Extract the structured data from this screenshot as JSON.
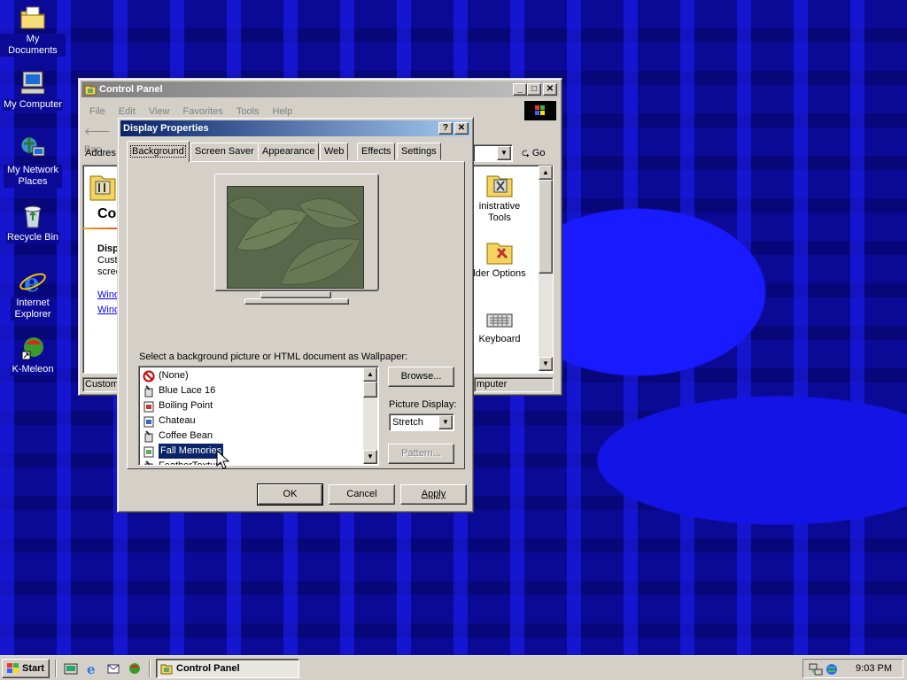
{
  "desktop": {
    "icons": [
      {
        "label": "My Documents",
        "icon": "folder-documents-icon"
      },
      {
        "label": "My Computer",
        "icon": "computer-icon"
      },
      {
        "label": "My Network Places",
        "icon": "network-icon"
      },
      {
        "label": "Recycle Bin",
        "icon": "recycle-bin-icon"
      },
      {
        "label": "Internet Explorer",
        "icon": "internet-explorer-icon"
      },
      {
        "label": "K-Meleon",
        "icon": "k-meleon-icon"
      }
    ]
  },
  "control_panel": {
    "title": "Control Panel",
    "menu": [
      "File",
      "Edit",
      "View",
      "Favorites",
      "Tools",
      "Help"
    ],
    "back_label": "Bac",
    "address_label": "Addres",
    "go_label": "Go",
    "heading": "Cor",
    "info_title": "Displ",
    "info_lines": [
      "Custo",
      "scree"
    ],
    "links": [
      "Windo",
      "Windo"
    ],
    "items": [
      {
        "label": "inistrative Tools",
        "icon": "administrative-tools-icon"
      },
      {
        "label": "lder Options",
        "icon": "folder-options-icon"
      },
      {
        "label": "Keyboard",
        "icon": "keyboard-icon"
      }
    ],
    "status_left": "Customi",
    "status_right": "mputer"
  },
  "display_properties": {
    "title": "Display Properties",
    "tabs": [
      "Background",
      "Screen Saver",
      "Appearance",
      "Web",
      "Effects",
      "Settings"
    ],
    "active_tab": "Background",
    "wallpaper_label": "Select a background picture or HTML document as Wallpaper:",
    "wallpapers": [
      "(None)",
      "Blue Lace 16",
      "Boiling Point",
      "Chateau",
      "Coffee Bean",
      "Fall Memories",
      "FeatherTexture"
    ],
    "selected_wallpaper": "Fall Memories",
    "browse_label": "Browse...",
    "picture_display_label": "Picture Display:",
    "picture_display_value": "Stretch",
    "pattern_label": "Pattern...",
    "ok_label": "OK",
    "cancel_label": "Cancel",
    "apply_label": "Apply"
  },
  "taskbar": {
    "start_label": "Start",
    "task_label": "Control Panel",
    "clock": "9:03 PM"
  },
  "colors": {
    "desktop": "#0a0a96",
    "title_active": "#0a246a",
    "title_inactive": "#808080",
    "selection": "#0a246a"
  }
}
